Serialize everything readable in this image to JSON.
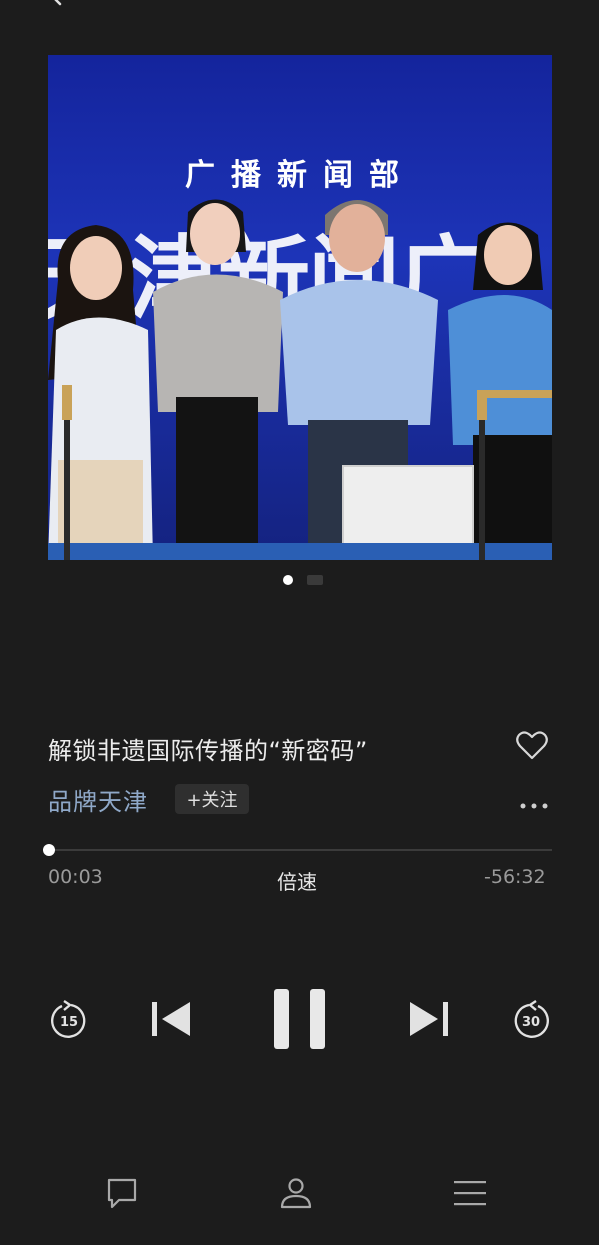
{
  "artwork": {
    "banner_text": "广播新闻部",
    "background_text": "天津新闻广",
    "slides_total": 2,
    "current_slide": 1
  },
  "episode": {
    "title": "解锁非遗国际传播的“新密码”",
    "channel": "品牌天津",
    "follow_label": "+关注"
  },
  "player": {
    "elapsed": "00:03",
    "remaining": "-56:32",
    "speed_label": "倍速",
    "progress_fraction": 0.001,
    "rewind_seconds": "15",
    "forward_seconds": "30"
  },
  "colors": {
    "background": "#1c1c1c",
    "channel_link": "#8fa8c8"
  },
  "icons": {
    "back": "chevron-left-icon",
    "favorite": "heart-icon",
    "more": "more-dots-icon",
    "rewind": "rewind-15-icon",
    "previous": "previous-track-icon",
    "pause": "pause-icon",
    "next": "next-track-icon",
    "forward": "forward-30-icon",
    "comment": "comment-icon",
    "profile": "profile-icon",
    "playlist": "playlist-icon"
  }
}
